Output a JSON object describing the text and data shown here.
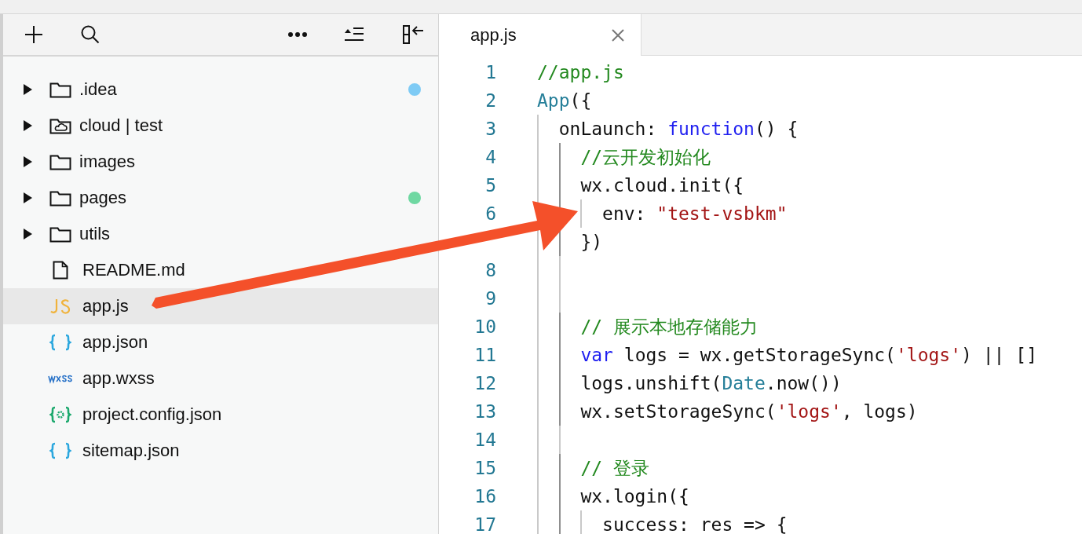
{
  "sidebar": {
    "tree": [
      {
        "kind": "folder",
        "label": ".idea",
        "expanded": false,
        "selected": false,
        "color": "#7ecbf5"
      },
      {
        "kind": "cloudfolder",
        "label": "cloud | test",
        "expanded": false,
        "selected": false
      },
      {
        "kind": "folder",
        "label": "images",
        "expanded": false,
        "selected": false
      },
      {
        "kind": "folder",
        "label": "pages",
        "expanded": false,
        "selected": false,
        "color": "#6fd8a2"
      },
      {
        "kind": "folder",
        "label": "utils",
        "expanded": false,
        "selected": false
      },
      {
        "kind": "document",
        "label": "README.md",
        "selected": false
      },
      {
        "kind": "script",
        "label": "app.js",
        "selected": true
      },
      {
        "kind": "json",
        "label": "app.json",
        "selected": false
      },
      {
        "kind": "stylesheet",
        "label": "app.wxss",
        "selected": false
      },
      {
        "kind": "config",
        "label": "project.config.json",
        "selected": false
      },
      {
        "kind": "json",
        "label": "sitemap.json",
        "selected": false
      }
    ]
  },
  "editor": {
    "tabs": [
      {
        "label": "app.js",
        "selected": true
      }
    ],
    "lines": [
      {
        "number": "1",
        "tokens": [
          {
            "kind": "comment",
            "text": "//app.js"
          }
        ]
      },
      {
        "number": "2",
        "tokens": [
          {
            "kind": "type",
            "text": "App"
          },
          {
            "kind": "plain",
            "text": "({"
          }
        ]
      },
      {
        "number": "3",
        "tokens": [
          {
            "kind": "plain",
            "text": "  onLaunch: "
          },
          {
            "kind": "keyword",
            "text": "function"
          },
          {
            "kind": "plain",
            "text": "() {"
          }
        ]
      },
      {
        "number": "4",
        "tokens": [
          {
            "kind": "comment",
            "text": "    //云开发初始化"
          }
        ]
      },
      {
        "number": "5",
        "tokens": [
          {
            "kind": "plain",
            "text": "    wx.cloud.init({"
          }
        ]
      },
      {
        "number": "6",
        "tokens": [
          {
            "kind": "plain",
            "text": "      env: "
          },
          {
            "kind": "string",
            "text": "\"test-vsbkm\""
          }
        ]
      },
      {
        "tokens": [
          {
            "kind": "plain",
            "text": "    })"
          }
        ]
      },
      {
        "number": "8"
      },
      {
        "number": "9"
      },
      {
        "number": "10",
        "tokens": [
          {
            "kind": "comment",
            "text": "    // 展示本地存储能力"
          }
        ]
      },
      {
        "number": "11",
        "tokens": [
          {
            "kind": "keyword",
            "text": "    var"
          },
          {
            "kind": "plain",
            "text": " logs = wx.getStorageSync("
          },
          {
            "kind": "string",
            "text": "'logs'"
          },
          {
            "kind": "plain",
            "text": ") || []"
          }
        ]
      },
      {
        "number": "12",
        "tokens": [
          {
            "kind": "plain",
            "text": "    logs.unshift("
          },
          {
            "kind": "type",
            "text": "Date"
          },
          {
            "kind": "plain",
            "text": ".now())"
          }
        ]
      },
      {
        "number": "13",
        "tokens": [
          {
            "kind": "plain",
            "text": "    wx.setStorageSync("
          },
          {
            "kind": "string",
            "text": "'logs'"
          },
          {
            "kind": "plain",
            "text": ", logs)"
          }
        ]
      },
      {
        "number": "14"
      },
      {
        "number": "15",
        "tokens": [
          {
            "kind": "comment",
            "text": "    // 登录"
          }
        ]
      },
      {
        "number": "16",
        "tokens": [
          {
            "kind": "plain",
            "text": "    wx.login({"
          }
        ]
      },
      {
        "number": "17",
        "tokens": [
          {
            "kind": "plain",
            "text": "      success: res => {"
          }
        ]
      }
    ]
  }
}
